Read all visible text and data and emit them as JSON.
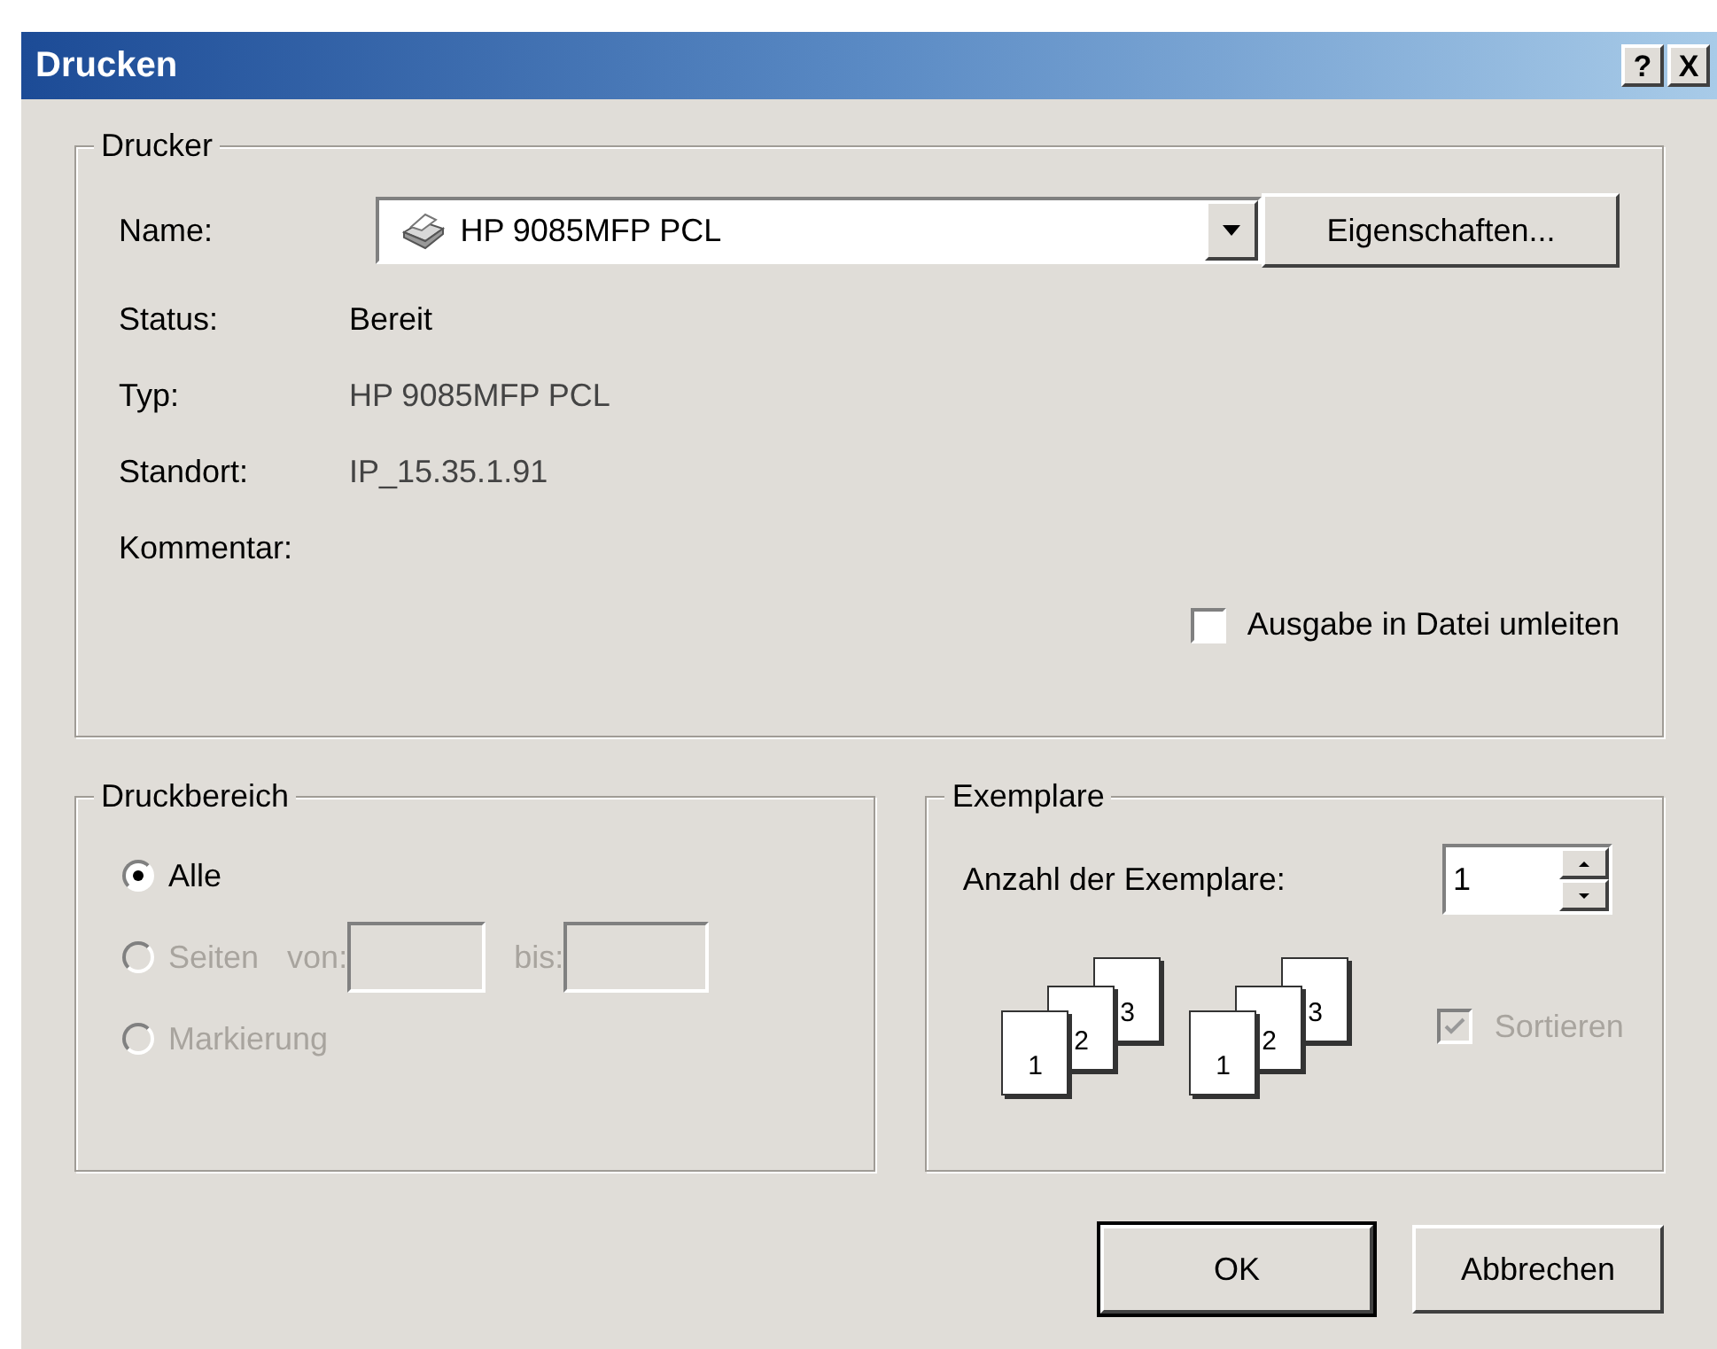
{
  "window": {
    "title": "Drucken",
    "title_buttons": [
      "?",
      "X"
    ]
  },
  "printer_group": {
    "legend": "Drucker",
    "name_label": "Name:",
    "printer_select": {
      "value": "HP 9085MFP PCL"
    },
    "properties_button": "Eigenschaften...",
    "info": [
      {
        "label": "Status:",
        "value": "Bereit"
      },
      {
        "label": "Typ:",
        "value": "HP 9085MFP PCL"
      },
      {
        "label": "Standort:",
        "value": "IP_15.35.1.91"
      },
      {
        "label": "Kommentar:"
      }
    ],
    "print_to_file": {
      "label": "Ausgabe in Datei umleiten",
      "checked": false
    }
  },
  "range_group": {
    "legend": "Druckbereich",
    "options": [
      {
        "label": "Alle",
        "selected": true,
        "disabled": false
      },
      {
        "label": "Seiten",
        "selected": false,
        "disabled": true,
        "from_label": "von:",
        "to_label": "bis:"
      },
      {
        "label": "Markierung",
        "selected": false,
        "disabled": true
      }
    ]
  },
  "copies_group": {
    "legend": "Exemplare",
    "count_label": "Anzahl der Exemplare:",
    "count": {
      "value": "1"
    },
    "collate_icons": [
      {
        "pages": [
          "1",
          "2",
          "3"
        ]
      },
      {
        "pages": [
          "1",
          "2",
          "3"
        ]
      }
    ],
    "collate": {
      "label": "Sortieren",
      "checked": true,
      "disabled": true
    }
  },
  "buttons": [
    {
      "label": "OK",
      "default": true
    },
    {
      "label": "Abbrechen",
      "default": false
    }
  ]
}
